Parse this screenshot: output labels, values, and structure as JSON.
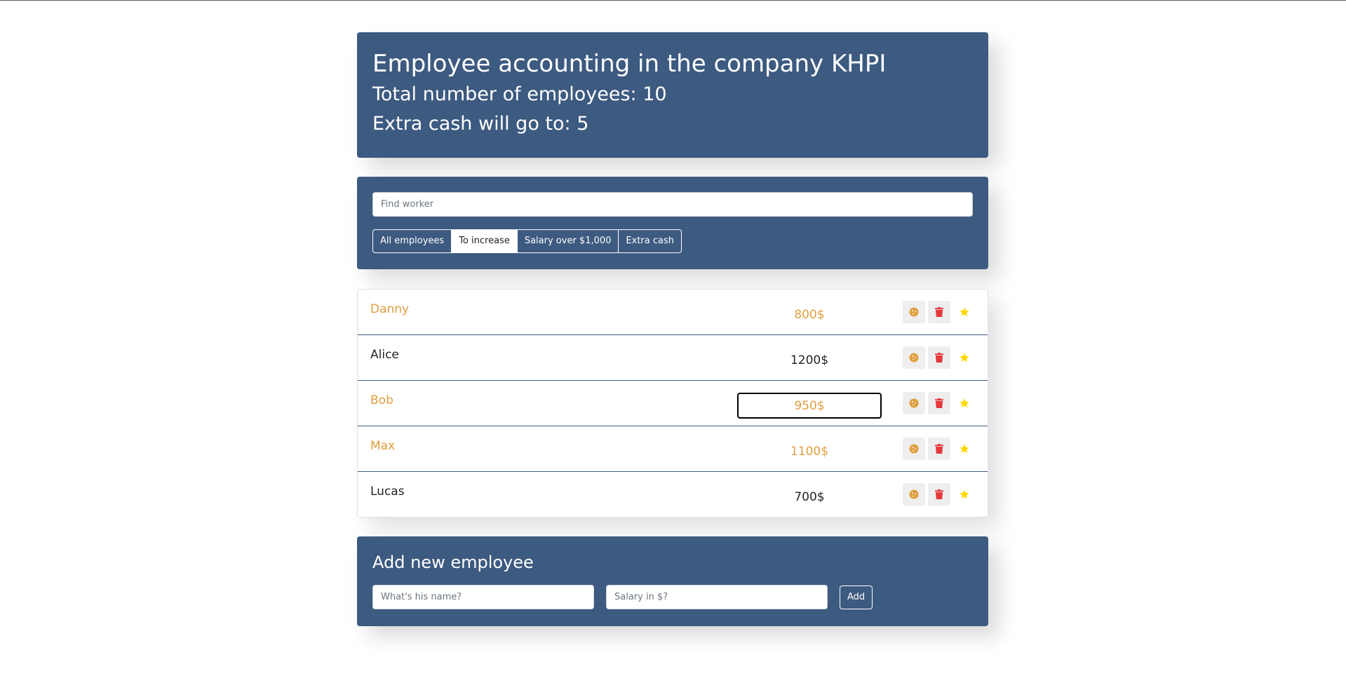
{
  "header": {
    "title": "Employee accounting in the company KHPI",
    "total_label": "Total number of employees: 10",
    "extra_label": "Extra cash will go to: 5"
  },
  "search": {
    "placeholder": "Find worker"
  },
  "filters": [
    {
      "label": "All employees",
      "active": false
    },
    {
      "label": "To increase",
      "active": true
    },
    {
      "label": "Salary over $1,000",
      "active": false
    },
    {
      "label": "Extra cash",
      "active": false
    }
  ],
  "employees": [
    {
      "name": "Danny",
      "salary": "800$",
      "increase": true,
      "focused": false
    },
    {
      "name": "Alice",
      "salary": "1200$",
      "increase": false,
      "focused": false
    },
    {
      "name": "Bob",
      "salary": "950$",
      "increase": true,
      "focused": true
    },
    {
      "name": "Max",
      "salary": "1100$",
      "increase": true,
      "focused": false
    },
    {
      "name": "Lucas",
      "salary": "700$",
      "increase": false,
      "focused": false
    }
  ],
  "add_form": {
    "title": "Add new employee",
    "name_placeholder": "What's his name?",
    "salary_placeholder": "Salary in $?",
    "submit_label": "Add"
  },
  "colors": {
    "panel": "#3d5a80",
    "increase": "#e09f3e",
    "trash": "#e5383b",
    "star": "#ffd700"
  },
  "icons": {
    "cookie": "cookie-icon",
    "trash": "trash-icon",
    "star": "star-icon"
  }
}
